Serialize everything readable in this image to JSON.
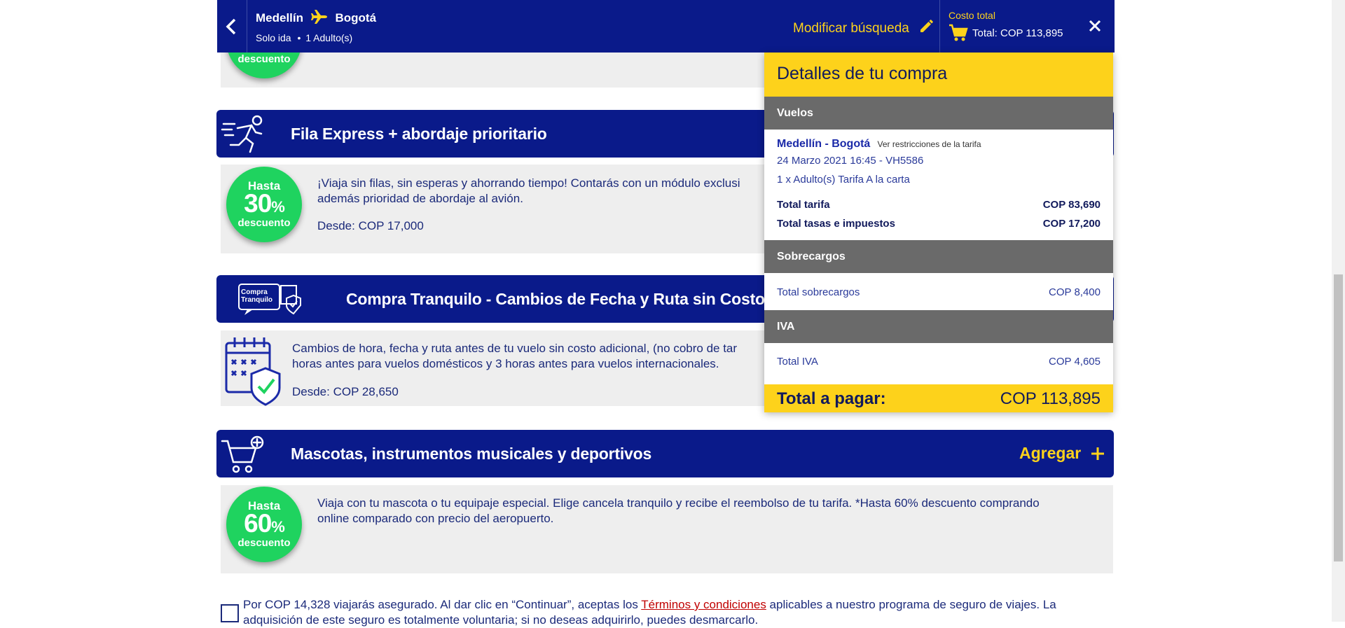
{
  "header": {
    "origin": "Medellín",
    "destination": "Bogotá",
    "trip_type": "Solo ida",
    "passengers": "1 Adulto(s)",
    "modify_label": "Modificar búsqueda",
    "cost_label": "Costo total",
    "cost_total": "Total: COP 113,895"
  },
  "services": [
    {
      "title": "Fila Express + abordaje prioritario",
      "badge": {
        "top": "Hasta",
        "number": "30",
        "unit": "%",
        "bottom": "descuento"
      },
      "description": "¡Viaja sin filas, sin esperas y ahorrando tiempo! Contarás con un módulo exclusi",
      "description2": "además prioridad de abordaje al avión.",
      "price": "Desde: COP 17,000"
    },
    {
      "title": "Compra Tranquilo - Cambios de Fecha y Ruta sin Costo A",
      "icon_text": "Compra Tranquilo",
      "description": "Cambios de hora, fecha y ruta antes de tu vuelo sin costo adicional, (no cobro de tar",
      "description2": "horas antes para vuelos domésticos y 3 horas antes para vuelos internacionales.",
      "price": "Desde: COP 28,650"
    },
    {
      "title": "Mascotas, instrumentos musicales y deportivos",
      "add_label": "Agregar",
      "badge": {
        "top": "Hasta",
        "number": "60",
        "unit": "%",
        "bottom": "descuento"
      },
      "description": "Viaja con tu mascota o tu equipaje especial. Elige cancela tranquilo y recibe el reembolso de tu tarifa. *Hasta 60% descuento comprando",
      "description2": "online comparado con precio del aeropuerto."
    }
  ],
  "top_badge_bottom": "descuento",
  "insurance": {
    "text_before": "Por COP 14,328 viajarás asegurado. Al dar clic en “Continuar”, aceptas los ",
    "link": "Términos y condiciones",
    "text_after": " aplicables a nuestro programa de seguro de viajes. La",
    "line2": "adquisición de este seguro es totalmente voluntaria; si no deseas adquirirlo, puedes desmarcarlo."
  },
  "details": {
    "title": "Detalles de tu compra",
    "flights_header": "Vuelos",
    "route": "Medellín - Bogotá",
    "restrictions_link": "Ver restricciones de la tarifa",
    "flight_info": "24 Marzo 2021 16:45 - VH5586",
    "fare_info": "1 x Adulto(s) Tarifa A la carta",
    "fare_label": "Total tarifa",
    "fare_value": "COP 83,690",
    "taxes_label": "Total tasas e impuestos",
    "taxes_value": "COP 17,200",
    "surcharges_header": "Sobrecargos",
    "surcharges_label": "Total sobrecargos",
    "surcharges_value": "COP 8,400",
    "iva_header": "IVA",
    "iva_label": "Total IVA",
    "iva_value": "COP 4,605",
    "total_label": "Total a pagar:",
    "total_value": "COP 113,895"
  },
  "colors": {
    "navy": "#0a1a8a",
    "yellow": "#fdd21b",
    "green": "#1fd35f",
    "gray_header": "#6a6a6a",
    "link_red": "#c00000"
  }
}
